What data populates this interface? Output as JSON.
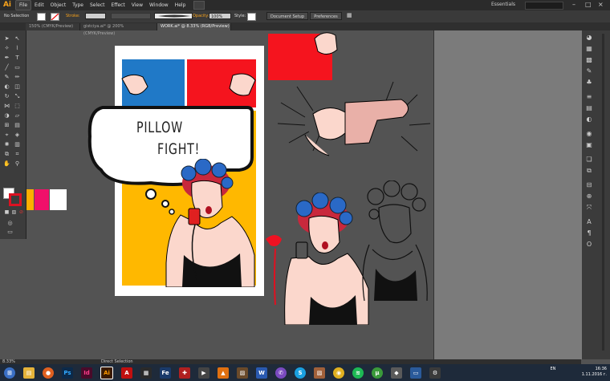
{
  "app": {
    "logo": "Ai"
  },
  "menu": [
    "File",
    "Edit",
    "Object",
    "Type",
    "Select",
    "Effect",
    "View",
    "Window",
    "Help"
  ],
  "workspace": {
    "essentials": "Essentials",
    "search_placeholder": ""
  },
  "control": {
    "selection_label": "No Selection",
    "stroke_label": "Stroke:",
    "opacity_label": "Opacity:",
    "opacity_value": "100%",
    "style_label": "Style:",
    "doc_setup": "Document Setup",
    "preferences": "Preferences"
  },
  "tabs": [
    {
      "label": "150% (CMYK/Preview)"
    },
    {
      "label": "gistciya.ai* @ 200% (CMYK/Preview)"
    },
    {
      "label": "WORK.ai* @ 8.33% (RGB/Preview)"
    }
  ],
  "status": {
    "zoom": "8.33%",
    "tool": "Direct Selection"
  },
  "artwork": {
    "line1": "PILLOW",
    "line2": "FIGHT!"
  },
  "tray": {
    "lang": "EN",
    "time": "16:36",
    "date": "1.11.2016 г."
  },
  "colors": {
    "yellow": "#FFB800",
    "red": "#F5141E",
    "blue": "#2079C7",
    "pink": "#F0106A",
    "orange": "#FFAE00"
  },
  "taskbar_icons": [
    "start-icon",
    "explorer-icon",
    "firefox-icon",
    "photoshop-icon",
    "indesign-icon",
    "illustrator-icon",
    "acrobat-icon",
    "apps-icon",
    "fe-icon",
    "pdf-icon",
    "media-icon",
    "vlc-icon",
    "image-icon",
    "word-icon",
    "viber-icon",
    "skype-icon",
    "photos-icon",
    "chrome-icon",
    "spotify-icon",
    "utorrent-icon",
    "game-icon",
    "monitor-icon",
    "system-icon"
  ]
}
